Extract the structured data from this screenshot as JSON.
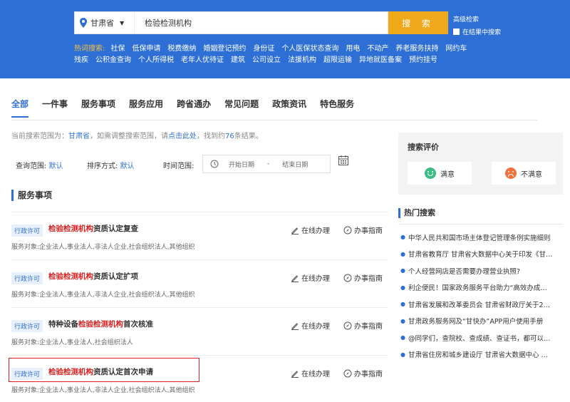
{
  "header": {
    "location": "甘肃省",
    "search_value": "检验检测机构",
    "search_button": "搜 索",
    "advanced_search": "高级检索",
    "search_in_results": "在结果中搜索",
    "hot_label": "热词搜索:",
    "hot_keywords": [
      "社保",
      "低保申请",
      "税费缴纳",
      "婚姻登记预约",
      "身份证",
      "个人医保状态查询",
      "用电",
      "不动产",
      "养老服务扶持",
      "网约车",
      "残疾",
      "公积金查询",
      "个人所得税",
      "老年人优待证",
      "建筑",
      "公司设立",
      "法援机构",
      "超限运输",
      "异地就医备案",
      "预约挂号"
    ]
  },
  "tabs": [
    "全部",
    "一件事",
    "服务事项",
    "服务应用",
    "跨省通办",
    "常见问题",
    "政策资讯",
    "特色服务"
  ],
  "scope": {
    "prefix": "当前搜索范围为：",
    "region": "甘肃省",
    "middle": "，如需调整搜索范围，请",
    "link": "点击此处",
    "found_prefix": "，找到约",
    "count": "76",
    "suffix": "条结果。"
  },
  "filters": {
    "range_label": "查询范围:",
    "range_value": "默认",
    "sort_label": "排序方式:",
    "sort_value": "默认",
    "time_label": "时间范围:",
    "start_placeholder": "开始日期",
    "separator": "-",
    "end_placeholder": "结束日期"
  },
  "section_title": "服务事项",
  "items": [
    {
      "tag": "行政许可",
      "pre": "",
      "hl": "检验检测机构",
      "post": "资质认定复查",
      "object": "服务对象:企业法人,事业法人,非法人企业,社会组织法人,其他组织",
      "online": "在线办理",
      "guide": "办事指南"
    },
    {
      "tag": "行政许可",
      "pre": "",
      "hl": "检验检测机构",
      "post": "资质认定扩项",
      "object": "服务对象:企业法人,事业法人,非法人企业,社会组织法人,其他组织",
      "online": "在线办理",
      "guide": "办事指南"
    },
    {
      "tag": "行政许可",
      "pre": "特种设备",
      "hl": "检验检测机构",
      "post": "首次核准",
      "object": "服务对象:企业法人,事业法人,社会组织法人",
      "online": "在线办理",
      "guide": "办事指南"
    },
    {
      "tag": "行政许可",
      "pre": "",
      "hl": "检验检测机构",
      "post": "资质认定首次申请",
      "object": "服务对象:企业法人,事业法人,非法人企业,社会组织法人,其他组织",
      "online": "在线办理",
      "guide": "办事指南"
    }
  ],
  "evaluation": {
    "title": "搜索评价",
    "good": "满意",
    "bad": "不满意"
  },
  "hot_search": {
    "title": "热门搜索",
    "items": [
      "中华人民共和国市场主体登记管理条例实施细则",
      "甘肃省教育厅 甘肃省大数据中心关于印发《甘…",
      "个人经营网店是否需要办理营业执照?",
      "利企便民！国家政务服务平台助力“高效办成…",
      "甘肃省发展和改革委员会 甘肃省财政厅关于2…",
      "甘肃政务服务网及“甘快办”APP用户使用手册",
      "@同学们，查院校、查成绩、查证书，都可以…",
      "甘肃省住房和城乡建设厅 甘肃省大数据中心 …"
    ]
  }
}
